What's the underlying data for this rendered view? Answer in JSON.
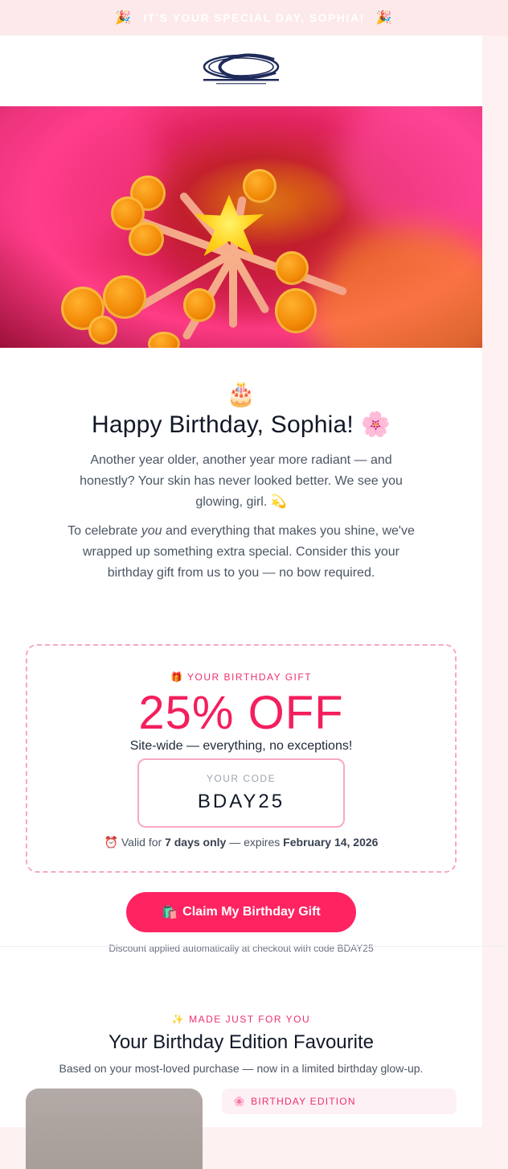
{
  "banner": {
    "text": "IT'S YOUR SPECIAL DAY, SOPHIA!",
    "left_emoji": "🎉",
    "right_emoji": "🎉"
  },
  "logo": {
    "icon": "company-logo"
  },
  "hero": {
    "icon": "flower-macro-image"
  },
  "greeting": {
    "cake_emoji": "🎂",
    "headline": "Happy Birthday, Sophia!",
    "headline_emoji": "🌸",
    "para1": "Another year older, another year more radiant — and honestly? Your skin has never looked better. We see you glowing, girl.",
    "para1_emoji": "💫",
    "para2_pre": "To celebrate",
    "para2_em": "you",
    "para2_post": "and everything that makes you shine, we've wrapped up something extra special. Consider this your birthday gift from us to you — no bow required."
  },
  "gift": {
    "eyebrow_emoji": "🎁",
    "eyebrow": "YOUR BIRTHDAY GIFT",
    "amount": "25% OFF",
    "subtitle": "Site-wide — everything, no exceptions!",
    "code_label": "YOUR CODE",
    "code": "BDAY25",
    "validity_emoji": "⏰",
    "validity_pre": "Valid for",
    "validity_bold1": "7 days only",
    "validity_mid": "— expires",
    "validity_bold2": "February 14, 2026"
  },
  "cta": {
    "emoji": "🛍️",
    "label": "Claim My Birthday Gift",
    "note": "Discount applied automatically at checkout with code BDAY25"
  },
  "section2": {
    "eyebrow_emoji": "✨",
    "eyebrow": "MADE JUST FOR YOU",
    "title": "Your Birthday Edition Favourite",
    "subtitle": "Based on your most-loved purchase — now in a limited birthday glow-up.",
    "badge_emoji": "🌸",
    "badge": "BIRTHDAY EDITION"
  },
  "colors": {
    "accent": "#ff2361",
    "accent_text": "#ef2f6b",
    "dashed_border": "#f7a8c7",
    "banner_bg": "#fde9ea"
  }
}
